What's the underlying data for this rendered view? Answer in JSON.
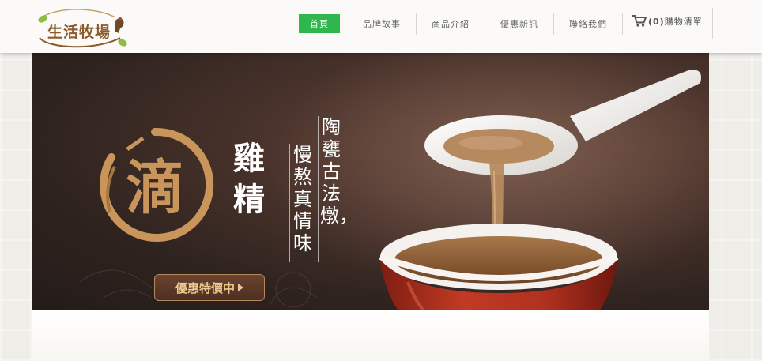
{
  "brand": {
    "logo_text": "生活牧場"
  },
  "nav": {
    "items": [
      {
        "label": "首頁",
        "active": true
      },
      {
        "label": "品牌故事"
      },
      {
        "label": "商品介紹"
      },
      {
        "label": "優惠新訊"
      },
      {
        "label": "聯絡我們"
      }
    ],
    "cart": {
      "count": "(0)",
      "label": "購物清單"
    }
  },
  "banner": {
    "emblem_char": "滴",
    "title": "雞精",
    "slogan_right": "陶甕古法燉，",
    "slogan_left": "慢熬真情味",
    "promo_button": "優惠特價中"
  },
  "colors": {
    "accent_green": "#2fb64d",
    "banner_dark": "#2f231f",
    "gold": "#c9955a",
    "cup_red": "#b0301f"
  }
}
